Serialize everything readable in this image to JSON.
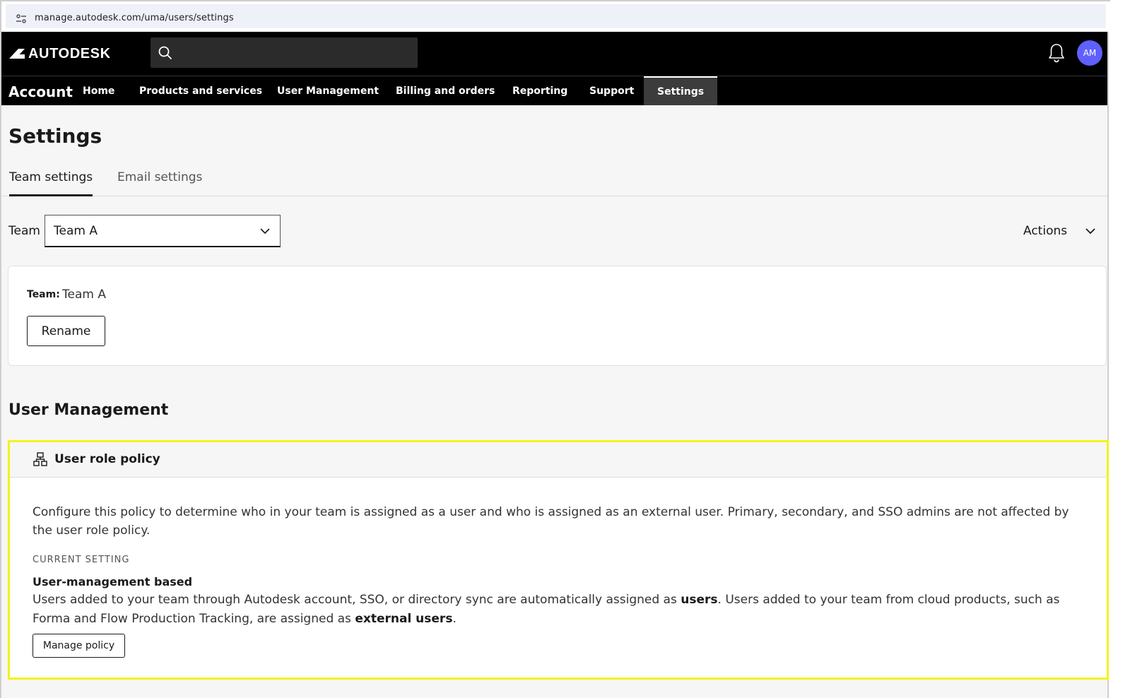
{
  "browser": {
    "url": "manage.autodesk.com/uma/users/settings"
  },
  "header": {
    "logo_text": "AUTODESK",
    "search_placeholder": "",
    "avatar_initials": "AM",
    "avatar_color": "#5f60ff"
  },
  "nav": {
    "brand": "Account",
    "items": [
      {
        "label": "Home",
        "active": false
      },
      {
        "label": "Products and services",
        "active": false
      },
      {
        "label": "User Management",
        "active": false
      },
      {
        "label": "Billing and orders",
        "active": false
      },
      {
        "label": "Reporting",
        "active": false
      },
      {
        "label": "Support",
        "active": false
      },
      {
        "label": "Settings",
        "active": true
      }
    ]
  },
  "page": {
    "title": "Settings",
    "tabs": [
      {
        "label": "Team settings",
        "active": true
      },
      {
        "label": "Email settings",
        "active": false
      }
    ]
  },
  "team_selector": {
    "label": "Team",
    "value": "Team A",
    "actions_label": "Actions"
  },
  "team_card": {
    "label": "Team:",
    "value": "Team A",
    "rename_label": "Rename"
  },
  "user_management": {
    "section_title": "User Management",
    "policy": {
      "title": "User role policy",
      "description": "Configure this policy to determine who in your team is assigned as a user and who is assigned as an external user. Primary, secondary, and SSO admins are not affected by the user role policy.",
      "current_setting_label": "CURRENT SETTING",
      "setting_name": "User-management based",
      "setting_desc_1": "Users added to your team through Autodesk account, SSO, or directory sync are automatically assigned as ",
      "setting_desc_bold_1": "users",
      "setting_desc_2": ". Users added to your team from cloud products, such as Forma and Flow Production Tracking, are assigned as ",
      "setting_desc_bold_2": "external users",
      "setting_desc_3": ".",
      "manage_label": "Manage policy",
      "highlight_color": "#f3f31d"
    }
  }
}
